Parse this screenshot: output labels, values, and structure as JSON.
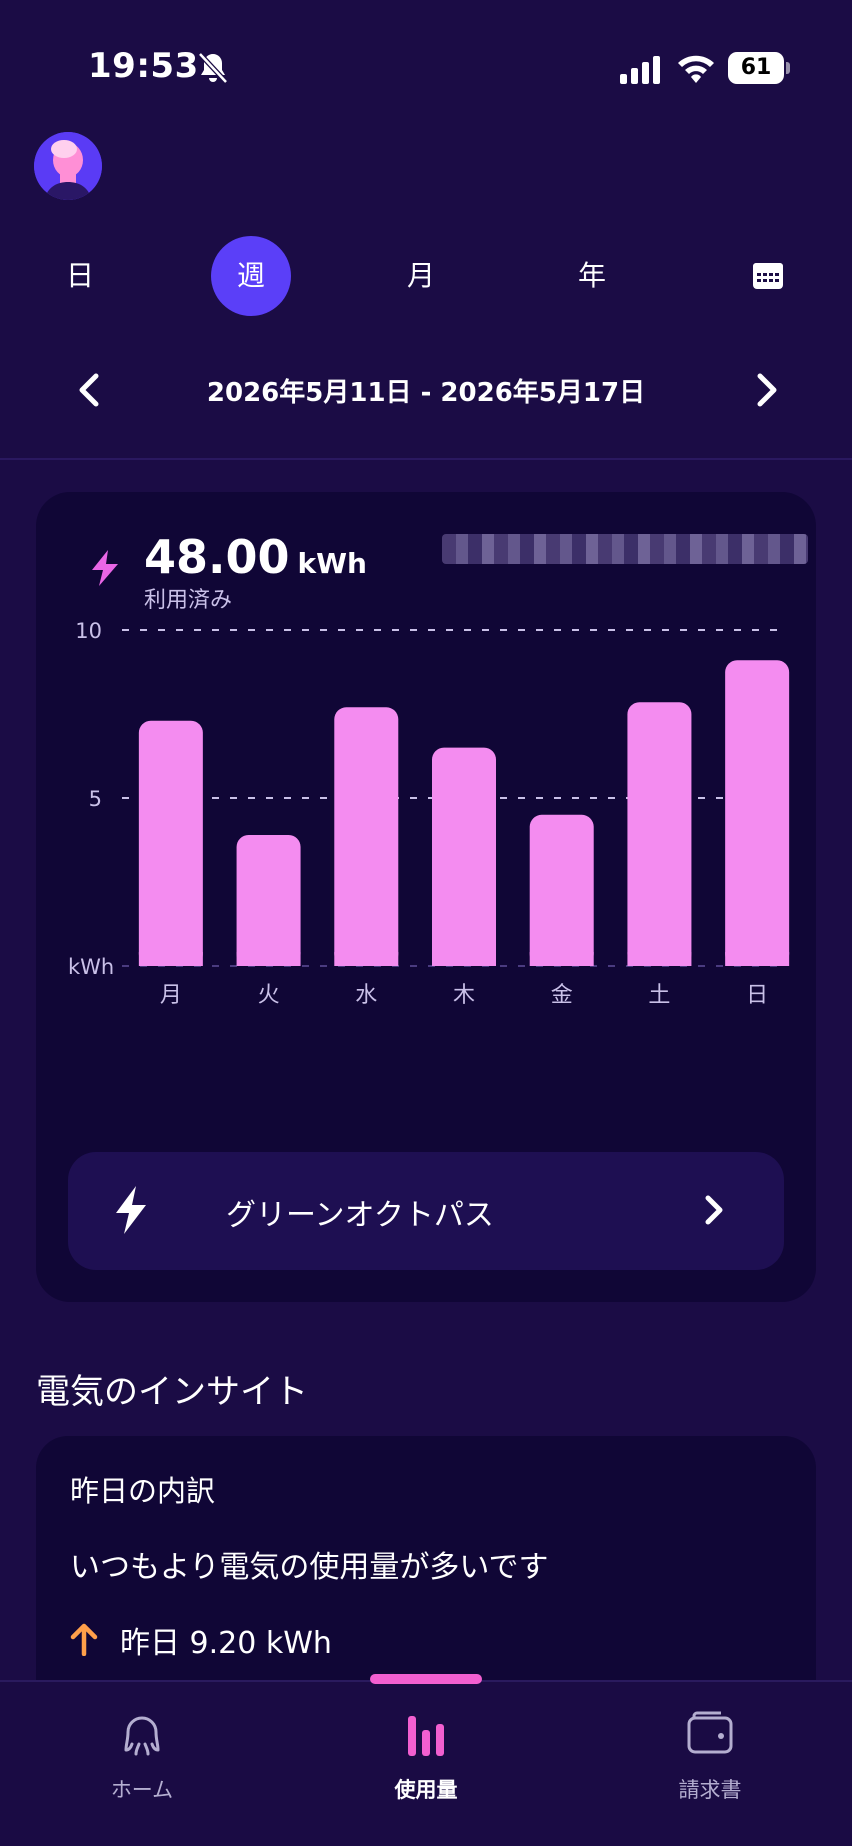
{
  "status_bar": {
    "time": "19:53",
    "battery": "61"
  },
  "period_tabs": [
    "日",
    "週",
    "月",
    "年"
  ],
  "active_period": "週",
  "date_range": "2026年5月11日 - 2026年5月17日",
  "usage": {
    "total_value": "48.00",
    "total_unit": "kWh",
    "total_label": "利用済み"
  },
  "chart_data": {
    "type": "bar",
    "categories": [
      "月",
      "火",
      "水",
      "木",
      "金",
      "土",
      "日"
    ],
    "values": [
      7.3,
      3.9,
      7.7,
      6.5,
      4.5,
      7.85,
      9.1
    ],
    "ylabel": "kWh",
    "ylim": [
      0,
      10
    ],
    "yticks": [
      10,
      5
    ],
    "grid": true,
    "bar_color": "#f48cf0"
  },
  "green_plan": {
    "label": "グリーンオクトパス"
  },
  "insights": {
    "title": "電気のインサイト",
    "card_heading": "昨日の内訳",
    "message": "いつもより電気の使用量が多いです",
    "yesterday": "昨日 9.20 kWh"
  },
  "bottom_nav": {
    "items": [
      {
        "label": "ホーム",
        "icon": "octopus-icon"
      },
      {
        "label": "使用量",
        "icon": "bar-chart-icon"
      },
      {
        "label": "請求書",
        "icon": "wallet-icon"
      }
    ],
    "active": "使用量"
  },
  "colors": {
    "background": "#1b0c45",
    "accent": "#5b3ff8",
    "bar": "#f48cf0",
    "bolt": "#e966e6",
    "up_arrow": "#ff9f4a"
  }
}
